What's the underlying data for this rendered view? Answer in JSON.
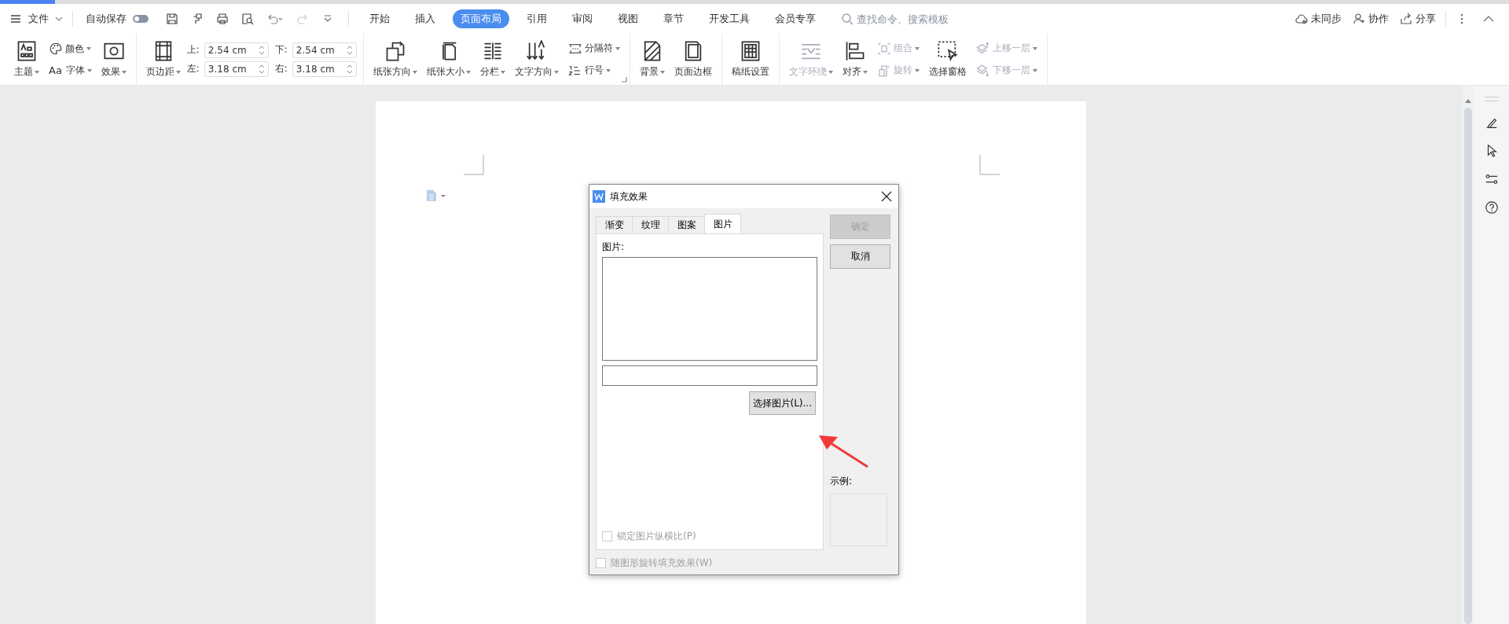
{
  "menu": {
    "file": "文件",
    "autosave": {
      "label": "自动保存",
      "on": false
    },
    "tabs": [
      {
        "label": "开始",
        "selected": false
      },
      {
        "label": "插入",
        "selected": false
      },
      {
        "label": "页面布局",
        "selected": true
      },
      {
        "label": "引用",
        "selected": false
      },
      {
        "label": "审阅",
        "selected": false
      },
      {
        "label": "视图",
        "selected": false
      },
      {
        "label": "章节",
        "selected": false
      },
      {
        "label": "开发工具",
        "selected": false
      },
      {
        "label": "会员专享",
        "selected": false
      }
    ],
    "search": {
      "placeholder": "查找命令、搜索模板"
    },
    "actions": [
      "未同步",
      "协作",
      "分享"
    ]
  },
  "ribbon": {
    "groups": [
      {
        "items": [
          {
            "kind": "large",
            "label": "主题",
            "dropdown": true,
            "disabled": false
          },
          {
            "kind": "stack",
            "items": [
              {
                "label": "颜色",
                "dropdown": true,
                "disabled": false
              },
              {
                "glyph": "Aa",
                "label": "字体",
                "dropdown": true,
                "disabled": false
              }
            ]
          },
          {
            "kind": "large",
            "label": "效果",
            "dropdown": true,
            "disabled": false
          }
        ]
      },
      {
        "items": [
          {
            "kind": "large",
            "label": "页边距",
            "dropdown": true,
            "disabled": false
          },
          {
            "kind": "fields",
            "fields": [
              {
                "label": "上:",
                "value": "2.54 cm"
              },
              {
                "label": "下:",
                "value": "2.54 cm"
              },
              {
                "label": "左:",
                "value": "3.18 cm"
              },
              {
                "label": "右:",
                "value": "3.18 cm"
              }
            ]
          }
        ]
      },
      {
        "launcher": true,
        "items": [
          {
            "kind": "large",
            "label": "纸张方向",
            "dropdown": true,
            "disabled": false
          },
          {
            "kind": "large",
            "label": "纸张大小",
            "dropdown": true,
            "disabled": false
          },
          {
            "kind": "large",
            "label": "分栏",
            "dropdown": true,
            "disabled": false
          },
          {
            "kind": "large",
            "label": "文字方向",
            "dropdown": true,
            "disabled": false
          },
          {
            "kind": "stack",
            "items": [
              {
                "label": "分隔符",
                "dropdown": true,
                "disabled": false
              },
              {
                "label": "行号",
                "dropdown": true,
                "disabled": false
              }
            ]
          }
        ]
      },
      {
        "items": [
          {
            "kind": "large",
            "label": "背景",
            "dropdown": true,
            "disabled": false
          },
          {
            "kind": "large",
            "label": "页面边框",
            "dropdown": false,
            "disabled": false
          }
        ]
      },
      {
        "items": [
          {
            "kind": "large",
            "label": "稿纸设置",
            "dropdown": false,
            "disabled": false
          }
        ]
      },
      {
        "items": [
          {
            "kind": "large",
            "label": "文字环绕",
            "dropdown": true,
            "disabled": true
          },
          {
            "kind": "large",
            "label": "对齐",
            "dropdown": true,
            "disabled": false
          },
          {
            "kind": "stack",
            "items": [
              {
                "label": "组合",
                "dropdown": true,
                "disabled": true
              },
              {
                "label": "旋转",
                "dropdown": true,
                "disabled": true
              }
            ]
          },
          {
            "kind": "large",
            "label": "选择窗格",
            "dropdown": false,
            "disabled": false
          },
          {
            "kind": "stack",
            "items": [
              {
                "label": "上移一层",
                "dropdown": true,
                "disabled": true
              },
              {
                "label": "下移一层",
                "dropdown": true,
                "disabled": true
              }
            ]
          }
        ]
      }
    ]
  },
  "dialog": {
    "title": "填充效果",
    "tabs": [
      {
        "label": "渐变",
        "selected": false
      },
      {
        "label": "纹理",
        "selected": false
      },
      {
        "label": "图案",
        "selected": false
      },
      {
        "label": "图片",
        "selected": true
      }
    ],
    "picture_label": "图片:",
    "select_button": "选择图片(L)...",
    "lock_ratio": {
      "label": "锁定图片纵横比(P)",
      "checked": false,
      "disabled": true
    },
    "rotate_with_shape": {
      "label": "随图形旋转填充效果(W)",
      "checked": false,
      "disabled": true
    },
    "ok": {
      "label": "确定",
      "disabled": true
    },
    "cancel": {
      "label": "取消",
      "disabled": false
    },
    "sample_label": "示例:"
  }
}
